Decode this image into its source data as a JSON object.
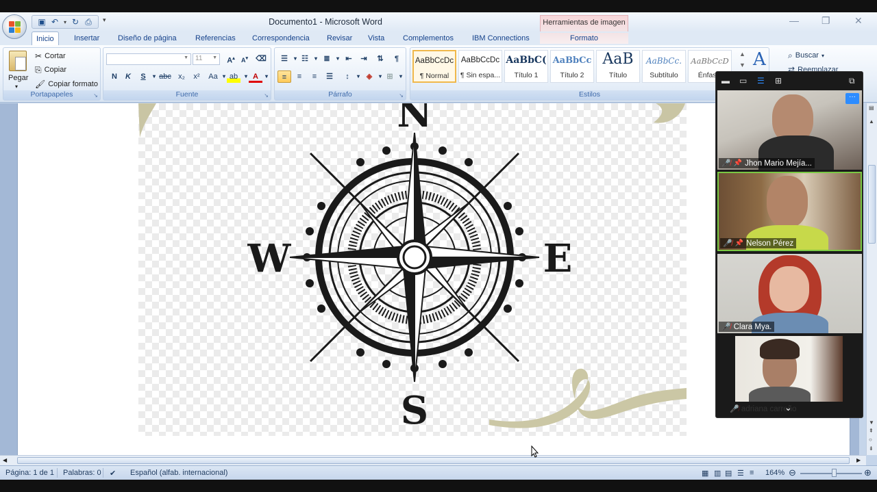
{
  "window": {
    "title": "Documento1 - Microsoft Word",
    "context_tab": "Herramientas de imagen"
  },
  "tabs": [
    "Inicio",
    "Insertar",
    "Diseño de página",
    "Referencias",
    "Correspondencia",
    "Revisar",
    "Vista",
    "Complementos",
    "IBM Connections",
    "Formato"
  ],
  "clipboard": {
    "paste": "Pegar",
    "cut": "Cortar",
    "copy": "Copiar",
    "format_painter": "Copiar formato",
    "label": "Portapapeles"
  },
  "font": {
    "size": "11",
    "bold": "N",
    "italic": "K",
    "underline": "S",
    "strike": "abc",
    "subscript": "x₂",
    "superscript": "x²",
    "change_case": "Aa",
    "grow": "A",
    "shrink": "A",
    "highlight": "ab",
    "color": "A",
    "label": "Fuente"
  },
  "paragraph": {
    "label": "Párrafo",
    "pilcrow": "¶"
  },
  "styles": {
    "label": "Estilos",
    "items": [
      {
        "preview": "AaBbCcDc",
        "name": "¶ Normal"
      },
      {
        "preview": "AaBbCcDc",
        "name": "¶ Sin espa..."
      },
      {
        "preview": "AaBbC(",
        "name": "Título 1"
      },
      {
        "preview": "AaBbCc",
        "name": "Título 2"
      },
      {
        "preview": "AaB",
        "name": "Título"
      },
      {
        "preview": "AaBbCc.",
        "name": "Subtítulo"
      },
      {
        "preview": "AaBbCcD",
        "name": "Énfasis"
      }
    ]
  },
  "editing": {
    "find": "Buscar",
    "replace": "Reemplazar"
  },
  "compass": {
    "north": "N",
    "south": "S",
    "east": "E",
    "west": "W"
  },
  "status": {
    "page": "Página: 1 de 1",
    "words": "Palabras: 0",
    "language": "Español (alfab. internacional)",
    "zoom": "164%"
  },
  "participants": [
    {
      "name": "Jhon Mario Mejía...",
      "muted": true,
      "pinned": true,
      "speaking": false
    },
    {
      "name": "Nelson Pérez",
      "muted": true,
      "pinned": true,
      "speaking": true
    },
    {
      "name": "Clara Mya.",
      "muted": true,
      "pinned": false,
      "speaking": false
    },
    {
      "name": "adriana carreño",
      "muted": true,
      "pinned": false,
      "speaking": false
    }
  ],
  "colors": {
    "ribbon_text": "#15428b",
    "speaking_border": "#7ac943",
    "zoom_blue": "#2d8cff",
    "mute_red": "#e03b3b"
  }
}
